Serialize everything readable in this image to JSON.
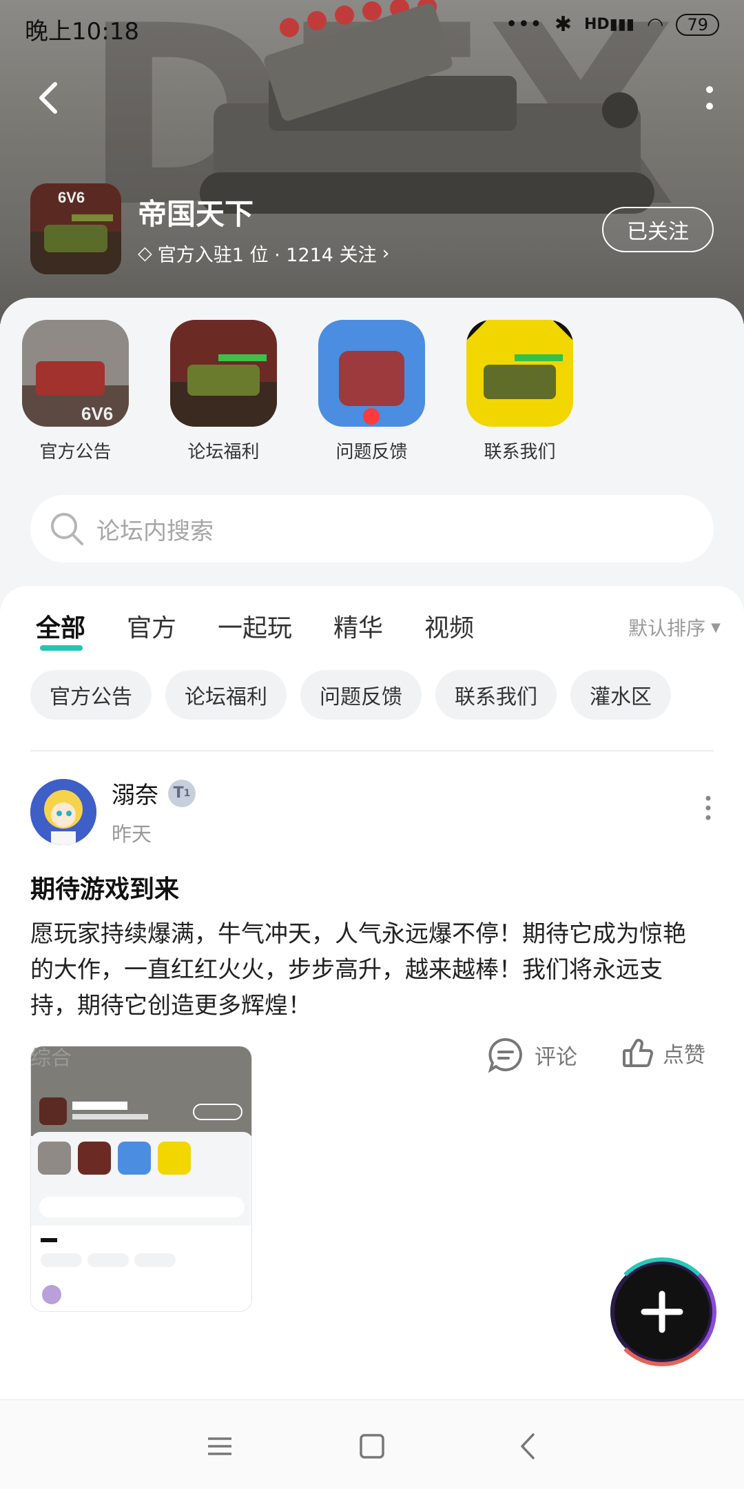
{
  "status_bar": {
    "time": "晚上10:18",
    "network": "HD",
    "battery": "79"
  },
  "game": {
    "title": "帝国天下",
    "subtitle": "官方入驻1 位 · 1214 关注",
    "follow_label": "已关注"
  },
  "quick_links": [
    {
      "label": "官方公告"
    },
    {
      "label": "论坛福利"
    },
    {
      "label": "问题反馈"
    },
    {
      "label": "联系我们"
    }
  ],
  "search": {
    "placeholder": "论坛内搜索"
  },
  "tabs": [
    {
      "label": "全部",
      "active": true
    },
    {
      "label": "官方"
    },
    {
      "label": "一起玩"
    },
    {
      "label": "精华"
    },
    {
      "label": "视频"
    }
  ],
  "sort_label": "默认排序",
  "chips": [
    "官方公告",
    "论坛福利",
    "问题反馈",
    "联系我们",
    "灌水区"
  ],
  "post": {
    "author": "溺奈",
    "level": "1",
    "time": "昨天",
    "title": "期待游戏到来",
    "body": "愿玩家持续爆满，牛气冲天，人气永远爆不停！期待它成为惊艳的大作，一直红红火火，步步高升，越来越棒！我们将永远支持，期待它创造更多辉煌！",
    "category": "综合",
    "comment_label": "评论",
    "like_label": "点赞"
  },
  "colors": {
    "accent": "#21c5b4"
  }
}
